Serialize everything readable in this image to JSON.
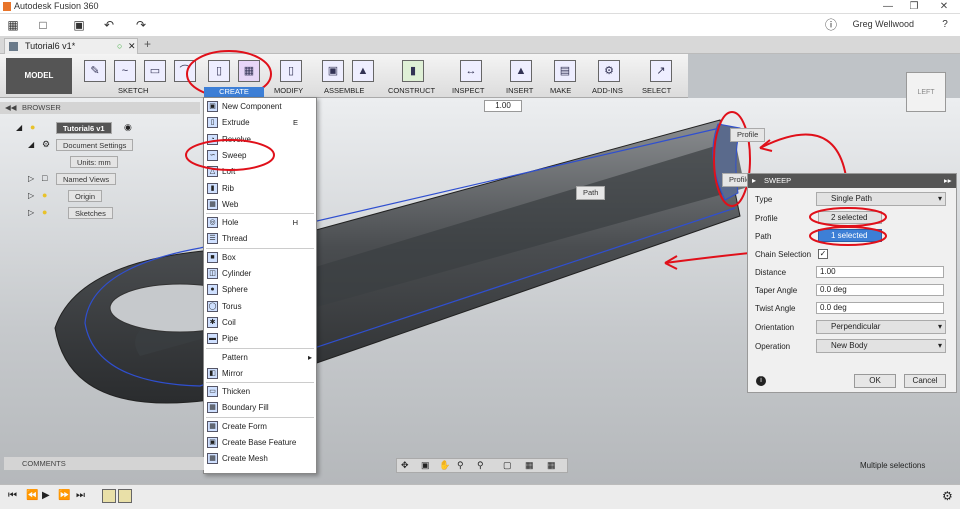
{
  "window": {
    "title": "Autodesk Fusion 360",
    "user": "Greg Wellwood"
  },
  "document": {
    "tab": "Tutorial6 v1*"
  },
  "toolbar": {
    "workspace": "MODEL",
    "groups": [
      "SKETCH",
      "CREATE",
      "MODIFY",
      "ASSEMBLE",
      "CONSTRUCT",
      "INSPECT",
      "INSERT",
      "MAKE",
      "ADD-INS",
      "SELECT"
    ]
  },
  "browser": {
    "title": "BROWSER",
    "root": "Tutorial6 v1",
    "items": [
      "Document Settings",
      "Units: mm",
      "Named Views",
      "Origin",
      "Sketches"
    ]
  },
  "scale_value": "1.00",
  "create_menu": {
    "items": [
      {
        "label": "New Component",
        "shortcut": ""
      },
      {
        "label": "Extrude",
        "shortcut": "E"
      },
      {
        "label": "Revolve",
        "shortcut": ""
      },
      {
        "label": "Sweep",
        "shortcut": ""
      },
      {
        "label": "Loft",
        "shortcut": ""
      },
      {
        "label": "Rib",
        "shortcut": ""
      },
      {
        "label": "Web",
        "shortcut": ""
      },
      {
        "label": "Hole",
        "shortcut": "H"
      },
      {
        "label": "Thread",
        "shortcut": ""
      },
      {
        "label": "Box",
        "shortcut": ""
      },
      {
        "label": "Cylinder",
        "shortcut": ""
      },
      {
        "label": "Sphere",
        "shortcut": ""
      },
      {
        "label": "Torus",
        "shortcut": ""
      },
      {
        "label": "Coil",
        "shortcut": ""
      },
      {
        "label": "Pipe",
        "shortcut": ""
      },
      {
        "label": "Pattern",
        "shortcut": ""
      },
      {
        "label": "Mirror",
        "shortcut": ""
      },
      {
        "label": "Thicken",
        "shortcut": ""
      },
      {
        "label": "Boundary Fill",
        "shortcut": ""
      },
      {
        "label": "Create Form",
        "shortcut": ""
      },
      {
        "label": "Create Base Feature",
        "shortcut": ""
      },
      {
        "label": "Create Mesh",
        "shortcut": ""
      }
    ]
  },
  "viewport": {
    "path_label": "Path",
    "profile_label_1": "Profile",
    "profile_label_2": "Profile",
    "cube_label": "LEFT"
  },
  "sweep_panel": {
    "title": "SWEEP",
    "fields": {
      "type": {
        "label": "Type",
        "value": "Single Path"
      },
      "profile": {
        "label": "Profile",
        "value": "2 selected"
      },
      "path": {
        "label": "Path",
        "value": "1 selected"
      },
      "chain": {
        "label": "Chain Selection"
      },
      "distance": {
        "label": "Distance",
        "value": "1.00"
      },
      "taper": {
        "label": "Taper Angle",
        "value": "0.0 deg"
      },
      "twist": {
        "label": "Twist Angle",
        "value": "0.0 deg"
      },
      "orientation": {
        "label": "Orientation",
        "value": "Perpendicular"
      },
      "operation": {
        "label": "Operation",
        "value": "New Body"
      }
    },
    "ok": "OK",
    "cancel": "Cancel"
  },
  "comments": "COMMENTS",
  "status": "Multiple selections",
  "colors": {
    "accent": "#3d7fd6",
    "annotation": "#e0101a",
    "path_line": "#2f4fd0"
  }
}
